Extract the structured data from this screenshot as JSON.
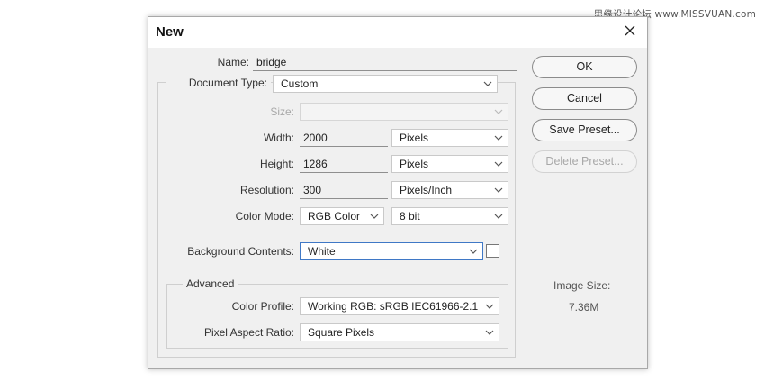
{
  "watermark": "思缘设计论坛 www.MISSVUAN.com",
  "dialog": {
    "title": "New",
    "close_icon": "close-icon"
  },
  "name": {
    "label": "Name:",
    "value": "bridge"
  },
  "document_type": {
    "label": "Document Type:",
    "value": "Custom"
  },
  "size": {
    "label": "Size:",
    "value": ""
  },
  "width": {
    "label": "Width:",
    "value": "2000",
    "unit": "Pixels"
  },
  "height": {
    "label": "Height:",
    "value": "1286",
    "unit": "Pixels"
  },
  "resolution": {
    "label": "Resolution:",
    "value": "300",
    "unit": "Pixels/Inch"
  },
  "color_mode": {
    "label": "Color Mode:",
    "value": "RGB Color",
    "depth": "8 bit"
  },
  "background": {
    "label": "Background Contents:",
    "value": "White",
    "swatch_color": "#ffffff"
  },
  "advanced": {
    "title": "Advanced",
    "color_profile": {
      "label": "Color Profile:",
      "value": "Working RGB:  sRGB IEC61966-2.1"
    },
    "pixel_aspect": {
      "label": "Pixel Aspect Ratio:",
      "value": "Square Pixels"
    }
  },
  "buttons": {
    "ok": "OK",
    "cancel": "Cancel",
    "save_preset": "Save Preset...",
    "delete_preset": "Delete Preset..."
  },
  "image_size": {
    "label": "Image Size:",
    "value": "7.36M"
  },
  "colors": {
    "accent_focus": "#3f78c6",
    "dialog_bg": "#f0f0f0"
  }
}
